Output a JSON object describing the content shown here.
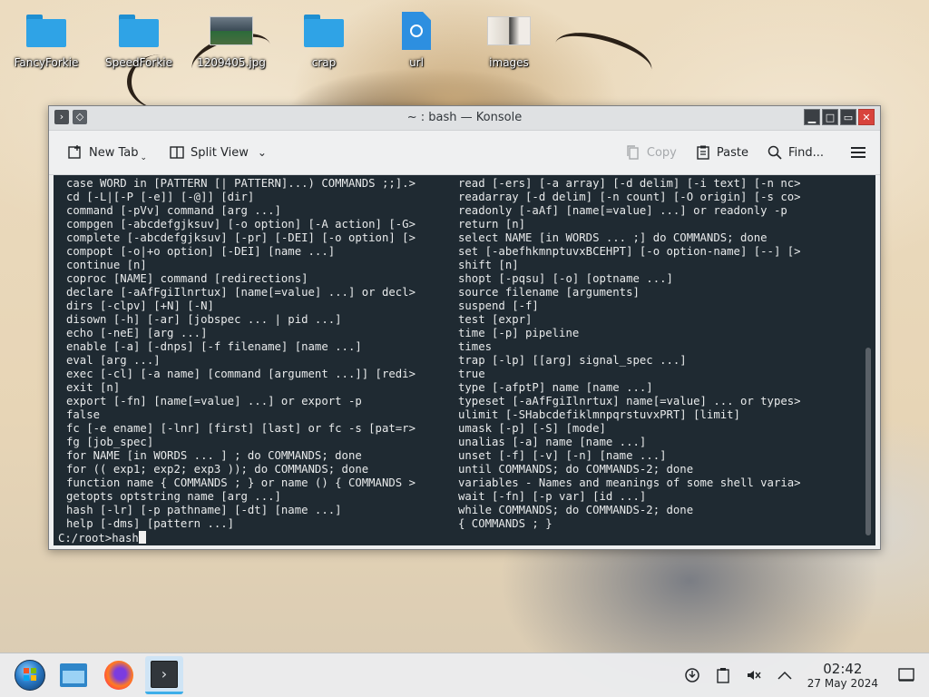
{
  "desktop": {
    "icons": [
      {
        "label": "FancyForkie",
        "icon": "folder-icon"
      },
      {
        "label": "SpeedForkie",
        "icon": "folder-icon"
      },
      {
        "label": "1209405.jpg",
        "icon": "image-thumbnail-icon"
      },
      {
        "label": "crap",
        "icon": "folder-icon"
      },
      {
        "label": "url",
        "icon": "url-file-icon"
      },
      {
        "label": "images",
        "icon": "image-thumbnail-icon"
      }
    ]
  },
  "window": {
    "title": "~ : bash — Konsole",
    "toolbar": {
      "new_tab": "New Tab",
      "split_view": "Split View",
      "copy": "Copy",
      "paste": "Paste",
      "find": "Find..."
    }
  },
  "terminal": {
    "left_lines": [
      "case WORD in [PATTERN [| PATTERN]...) COMMANDS ;;].>",
      "cd [-L|[-P [-e]] [-@]] [dir]",
      "command [-pVv] command [arg ...]",
      "compgen [-abcdefgjksuv] [-o option] [-A action] [-G>",
      "complete [-abcdefgjksuv] [-pr] [-DEI] [-o option] [>",
      "compopt [-o|+o option] [-DEI] [name ...]",
      "continue [n]",
      "coproc [NAME] command [redirections]",
      "declare [-aAfFgiIlnrtux] [name[=value] ...] or decl>",
      "dirs [-clpv] [+N] [-N]",
      "disown [-h] [-ar] [jobspec ... | pid ...]",
      "echo [-neE] [arg ...]",
      "enable [-a] [-dnps] [-f filename] [name ...]",
      "eval [arg ...]",
      "exec [-cl] [-a name] [command [argument ...]] [redi>",
      "exit [n]",
      "export [-fn] [name[=value] ...] or export -p",
      "false",
      "fc [-e ename] [-lnr] [first] [last] or fc -s [pat=r>",
      "fg [job_spec]",
      "for NAME [in WORDS ... ] ; do COMMANDS; done",
      "for (( exp1; exp2; exp3 )); do COMMANDS; done",
      "function name { COMMANDS ; } or name () { COMMANDS >",
      "getopts optstring name [arg ...]",
      "hash [-lr] [-p pathname] [-dt] [name ...]",
      "help [-dms] [pattern ...]"
    ],
    "right_lines": [
      "read [-ers] [-a array] [-d delim] [-i text] [-n nc>",
      "readarray [-d delim] [-n count] [-O origin] [-s co>",
      "readonly [-aAf] [name[=value] ...] or readonly -p",
      "return [n]",
      "select NAME [in WORDS ... ;] do COMMANDS; done",
      "set [-abefhkmnptuvxBCEHPT] [-o option-name] [--] [>",
      "shift [n]",
      "shopt [-pqsu] [-o] [optname ...]",
      "source filename [arguments]",
      "suspend [-f]",
      "test [expr]",
      "time [-p] pipeline",
      "times",
      "trap [-lp] [[arg] signal_spec ...]",
      "true",
      "type [-afptP] name [name ...]",
      "typeset [-aAfFgiIlnrtux] name[=value] ... or types>",
      "ulimit [-SHabcdefiklmnpqrstuvxPRT] [limit]",
      "umask [-p] [-S] [mode]",
      "unalias [-a] name [name ...]",
      "unset [-f] [-v] [-n] [name ...]",
      "until COMMANDS; do COMMANDS-2; done",
      "variables - Names and meanings of some shell varia>",
      "wait [-fn] [-p var] [id ...]",
      "while COMMANDS; do COMMANDS-2; done",
      "{ COMMANDS ; }"
    ],
    "prompt": "C:/root>hash"
  },
  "taskbar": {
    "apps": [
      "start-menu-icon",
      "file-manager-icon",
      "firefox-icon",
      "konsole-icon"
    ],
    "clock": {
      "time": "02:42",
      "date": "27 May 2024"
    }
  }
}
